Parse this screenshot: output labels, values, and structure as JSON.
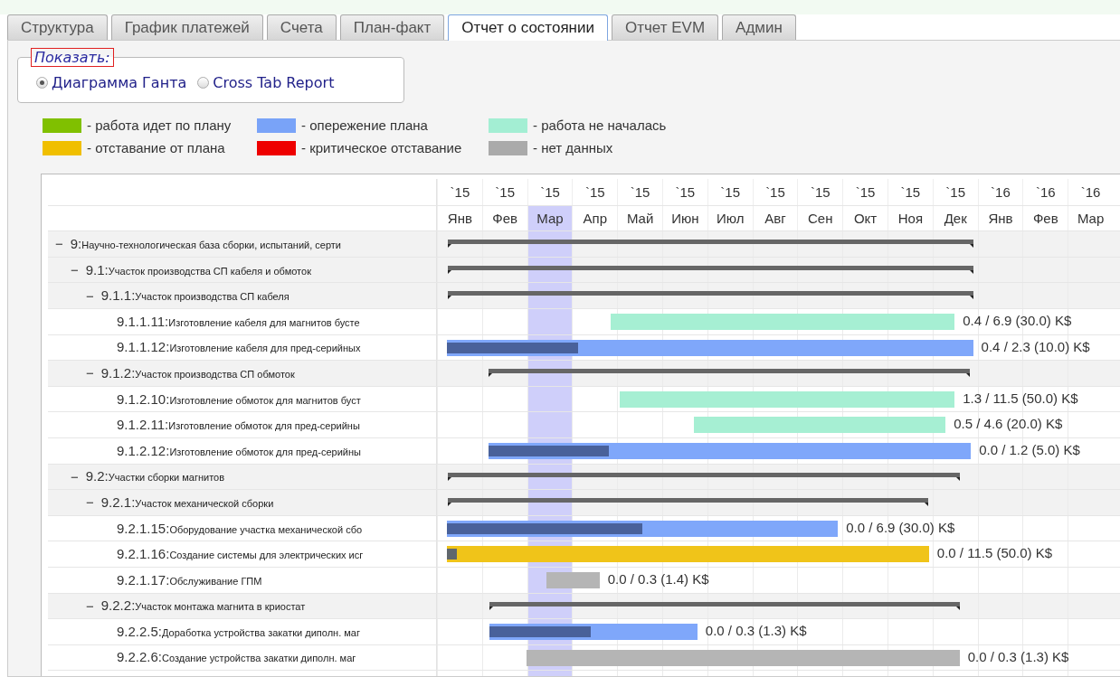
{
  "tabs": [
    {
      "label": "Структура",
      "selected": false
    },
    {
      "label": "График платежей",
      "selected": false
    },
    {
      "label": "Счета",
      "selected": false
    },
    {
      "label": "План-факт",
      "selected": false
    },
    {
      "label": "Отчет о состоянии",
      "selected": true
    },
    {
      "label": "Отчет EVM",
      "selected": false
    },
    {
      "label": "Админ",
      "selected": false
    }
  ],
  "show": {
    "legend": "Показать:",
    "options": [
      {
        "label": "Диаграмма Ганта",
        "selected": true
      },
      {
        "label": "Cross Tab Report",
        "selected": false
      }
    ]
  },
  "legend": [
    {
      "label": "- работа идет по плану",
      "color": "#80c000"
    },
    {
      "label": "- опережение плана",
      "color": "#79a3f8"
    },
    {
      "label": "- работа не началась",
      "color": "#a3eed3"
    },
    {
      "label": "- отставание от плана",
      "color": "#f0bf00"
    },
    {
      "label": "- критическое отставание",
      "color": "#ee0000"
    },
    {
      "label": "- нет данных",
      "color": "#aaaaaa"
    }
  ],
  "months": [
    {
      "year": "`15",
      "month": "Янв",
      "current": false
    },
    {
      "year": "`15",
      "month": "Фев",
      "current": false
    },
    {
      "year": "`15",
      "month": "Мар",
      "current": true
    },
    {
      "year": "`15",
      "month": "Апр",
      "current": false
    },
    {
      "year": "`15",
      "month": "Май",
      "current": false
    },
    {
      "year": "`15",
      "month": "Июн",
      "current": false
    },
    {
      "year": "`15",
      "month": "Июл",
      "current": false
    },
    {
      "year": "`15",
      "month": "Авг",
      "current": false
    },
    {
      "year": "`15",
      "month": "Сен",
      "current": false
    },
    {
      "year": "`15",
      "month": "Окт",
      "current": false
    },
    {
      "year": "`15",
      "month": "Ноя",
      "current": false
    },
    {
      "year": "`15",
      "month": "Дек",
      "current": false
    },
    {
      "year": "`16",
      "month": "Янв",
      "current": false
    },
    {
      "year": "`16",
      "month": "Фев",
      "current": false
    },
    {
      "year": "`16",
      "month": "Мар",
      "current": false
    }
  ],
  "rows": [
    {
      "toggle": "−",
      "code": "9:",
      "name": "Научно-технологическая база сборки, испытаний, серти",
      "kind": "summary",
      "expanded": true,
      "children": [
        {
          "toggle": "−",
          "code": "9.1:",
          "name": "Участок производства СП кабеля и обмоток",
          "kind": "summary",
          "expanded": true,
          "children": [
            {
              "toggle": "−",
              "code": "9.1.1:",
              "name": "Участок производства СП кабеля",
              "kind": "summary",
              "expanded": true,
              "children": [
                {
                  "code": "9.1.1.11:",
                  "name": "Изготовление кабеля для магнитов бусте",
                  "kind": "task",
                  "color": "#a6efd3",
                  "cost": "0.4 / 6.9 (30.0) K$"
                },
                {
                  "code": "9.1.1.12:",
                  "name": "Изготовление кабеля для пред-серийных",
                  "kind": "task",
                  "color": "#7fa7fa",
                  "level": 0.25,
                  "cost": "0.4 / 2.3 (10.0) K$"
                }
              ]
            },
            {
              "toggle": "−",
              "code": "9.1.2:",
              "name": "Участок производства СП обмоток",
              "kind": "summary",
              "expanded": true,
              "children": [
                {
                  "code": "9.1.2.10:",
                  "name": "Изготовление обмоток для магнитов буст",
                  "kind": "task",
                  "color": "#a6efd3",
                  "cost": "1.3 / 11.5 (50.0) K$"
                },
                {
                  "code": "9.1.2.11:",
                  "name": "Изготовление обмоток для пред-серийны",
                  "kind": "task",
                  "color": "#a6efd3",
                  "cost": "0.5 / 4.6 (20.0) K$"
                },
                {
                  "code": "9.1.2.12:",
                  "name": "Изготовление обмоток для пред-серийны",
                  "kind": "task",
                  "color": "#7fa7fa",
                  "level": 0.25,
                  "cost": "0.0 / 1.2 (5.0) K$"
                }
              ]
            }
          ]
        },
        {
          "toggle": "−",
          "code": "9.2:",
          "name": "Участки сборки магнитов",
          "kind": "summary",
          "expanded": true,
          "children": [
            {
              "toggle": "−",
              "code": "9.2.1:",
              "name": "Участок механической сборки",
              "kind": "summary",
              "expanded": true,
              "children": [
                {
                  "code": "9.2.1.15:",
                  "name": "Оборудование участка механической сбо",
                  "kind": "task",
                  "color": "#7fa7fa",
                  "level": 0.5,
                  "cost": "0.0 / 6.9 (30.0) K$"
                },
                {
                  "code": "9.2.1.16:",
                  "name": "Создание системы для электрических исг",
                  "kind": "task",
                  "color": "#f0c419",
                  "level": 0.02,
                  "cost": "0.0 / 11.5 (50.0) K$"
                },
                {
                  "code": "9.2.1.17:",
                  "name": "Обслуживание ГПМ",
                  "kind": "task",
                  "color": "#b5b5b5",
                  "cost": "0.0 / 0.3 (1.4) K$"
                }
              ]
            },
            {
              "toggle": "−",
              "code": "9.2.2:",
              "name": "Участок монтажа магнита в криостат",
              "kind": "summary",
              "expanded": true,
              "children": [
                {
                  "code": "9.2.2.5:",
                  "name": "Доработка устройства закатки диполн. маг",
                  "kind": "task",
                  "color": "#7fa7fa",
                  "level": 0.49,
                  "cost": "0.0 / 0.3 (1.3) K$"
                },
                {
                  "code": "9.2.2.6:",
                  "name": "Создание устройства закатки диполн. маг",
                  "kind": "task",
                  "color": "#b5b5b5",
                  "cost": "0.0 / 0.3 (1.3) K$"
                }
              ]
            }
          ]
        }
      ]
    }
  ]
}
